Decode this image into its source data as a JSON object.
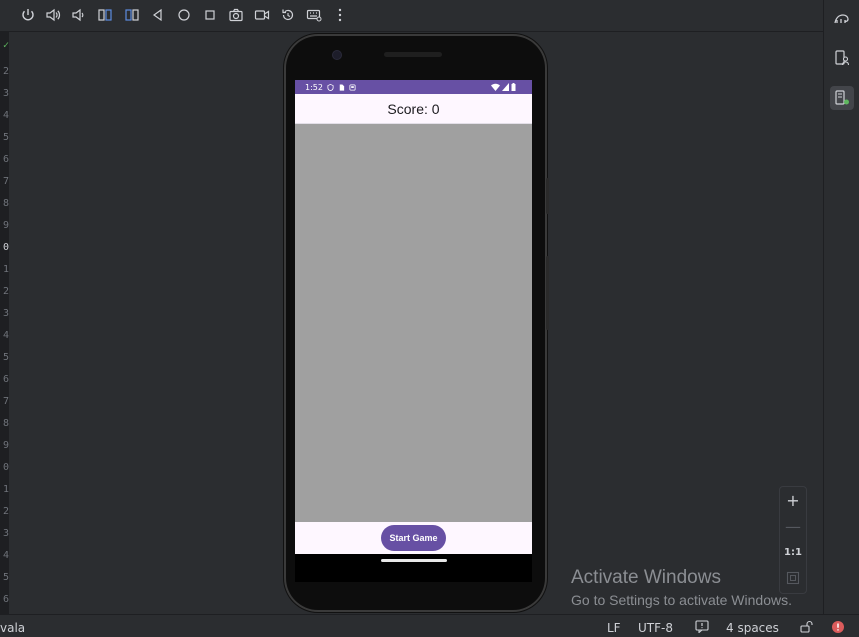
{
  "toolbar": {
    "icons": [
      "power-icon",
      "volume-up-icon",
      "volume-down-icon",
      "rotate-left-icon",
      "rotate-right-icon",
      "back-icon",
      "home-icon",
      "overview-icon",
      "camera-icon",
      "record-icon",
      "reset-icon",
      "keyboard-icon",
      "more-icon"
    ]
  },
  "gutter": {
    "lines": [
      "2",
      "3",
      "4",
      "5",
      "6",
      "7",
      "8",
      "9",
      "0",
      "1",
      "2",
      "3",
      "4",
      "5",
      "6",
      "7",
      "8",
      "9",
      "0",
      "1",
      "2",
      "3",
      "4",
      "5",
      "6"
    ]
  },
  "device": {
    "status_time": "1:52"
  },
  "app": {
    "score_label": "Score: 0",
    "start_button": "Start Game",
    "accent_color": "#6750a4",
    "game_area_color": "#a0a0a0"
  },
  "zoom": {
    "plus": "+",
    "minus": "—",
    "one_to_one": "1:1"
  },
  "watermark": {
    "title": "Activate Windows",
    "subtitle": "Go to Settings to activate Windows."
  },
  "statusline": {
    "left_fragment": "vala",
    "line_ending": "LF",
    "encoding": "UTF-8",
    "indent": "4 spaces"
  }
}
